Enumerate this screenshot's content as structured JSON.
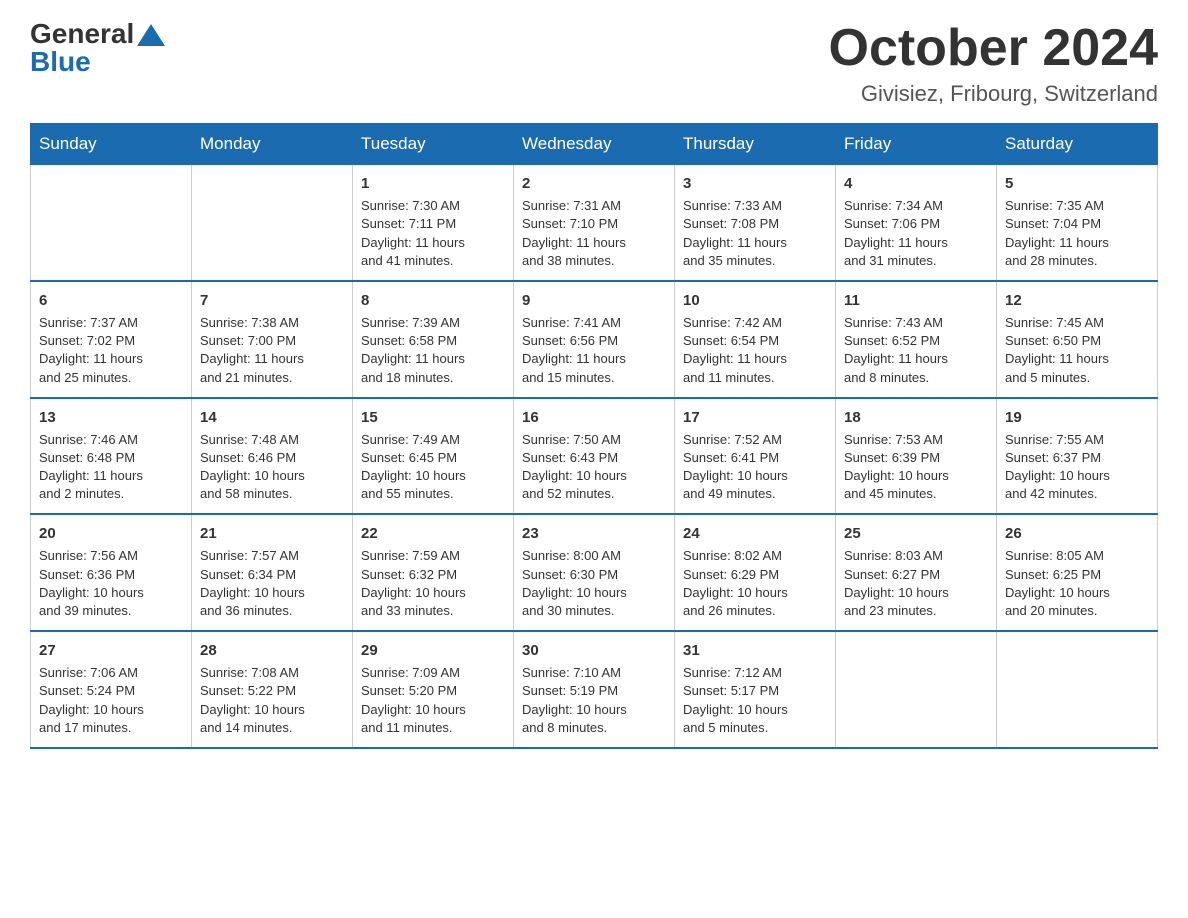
{
  "header": {
    "logo_general": "General",
    "logo_blue": "Blue",
    "month": "October 2024",
    "location": "Givisiez, Fribourg, Switzerland"
  },
  "days_of_week": [
    "Sunday",
    "Monday",
    "Tuesday",
    "Wednesday",
    "Thursday",
    "Friday",
    "Saturday"
  ],
  "weeks": [
    [
      {
        "day": "",
        "info": ""
      },
      {
        "day": "",
        "info": ""
      },
      {
        "day": "1",
        "info": "Sunrise: 7:30 AM\nSunset: 7:11 PM\nDaylight: 11 hours\nand 41 minutes."
      },
      {
        "day": "2",
        "info": "Sunrise: 7:31 AM\nSunset: 7:10 PM\nDaylight: 11 hours\nand 38 minutes."
      },
      {
        "day": "3",
        "info": "Sunrise: 7:33 AM\nSunset: 7:08 PM\nDaylight: 11 hours\nand 35 minutes."
      },
      {
        "day": "4",
        "info": "Sunrise: 7:34 AM\nSunset: 7:06 PM\nDaylight: 11 hours\nand 31 minutes."
      },
      {
        "day": "5",
        "info": "Sunrise: 7:35 AM\nSunset: 7:04 PM\nDaylight: 11 hours\nand 28 minutes."
      }
    ],
    [
      {
        "day": "6",
        "info": "Sunrise: 7:37 AM\nSunset: 7:02 PM\nDaylight: 11 hours\nand 25 minutes."
      },
      {
        "day": "7",
        "info": "Sunrise: 7:38 AM\nSunset: 7:00 PM\nDaylight: 11 hours\nand 21 minutes."
      },
      {
        "day": "8",
        "info": "Sunrise: 7:39 AM\nSunset: 6:58 PM\nDaylight: 11 hours\nand 18 minutes."
      },
      {
        "day": "9",
        "info": "Sunrise: 7:41 AM\nSunset: 6:56 PM\nDaylight: 11 hours\nand 15 minutes."
      },
      {
        "day": "10",
        "info": "Sunrise: 7:42 AM\nSunset: 6:54 PM\nDaylight: 11 hours\nand 11 minutes."
      },
      {
        "day": "11",
        "info": "Sunrise: 7:43 AM\nSunset: 6:52 PM\nDaylight: 11 hours\nand 8 minutes."
      },
      {
        "day": "12",
        "info": "Sunrise: 7:45 AM\nSunset: 6:50 PM\nDaylight: 11 hours\nand 5 minutes."
      }
    ],
    [
      {
        "day": "13",
        "info": "Sunrise: 7:46 AM\nSunset: 6:48 PM\nDaylight: 11 hours\nand 2 minutes."
      },
      {
        "day": "14",
        "info": "Sunrise: 7:48 AM\nSunset: 6:46 PM\nDaylight: 10 hours\nand 58 minutes."
      },
      {
        "day": "15",
        "info": "Sunrise: 7:49 AM\nSunset: 6:45 PM\nDaylight: 10 hours\nand 55 minutes."
      },
      {
        "day": "16",
        "info": "Sunrise: 7:50 AM\nSunset: 6:43 PM\nDaylight: 10 hours\nand 52 minutes."
      },
      {
        "day": "17",
        "info": "Sunrise: 7:52 AM\nSunset: 6:41 PM\nDaylight: 10 hours\nand 49 minutes."
      },
      {
        "day": "18",
        "info": "Sunrise: 7:53 AM\nSunset: 6:39 PM\nDaylight: 10 hours\nand 45 minutes."
      },
      {
        "day": "19",
        "info": "Sunrise: 7:55 AM\nSunset: 6:37 PM\nDaylight: 10 hours\nand 42 minutes."
      }
    ],
    [
      {
        "day": "20",
        "info": "Sunrise: 7:56 AM\nSunset: 6:36 PM\nDaylight: 10 hours\nand 39 minutes."
      },
      {
        "day": "21",
        "info": "Sunrise: 7:57 AM\nSunset: 6:34 PM\nDaylight: 10 hours\nand 36 minutes."
      },
      {
        "day": "22",
        "info": "Sunrise: 7:59 AM\nSunset: 6:32 PM\nDaylight: 10 hours\nand 33 minutes."
      },
      {
        "day": "23",
        "info": "Sunrise: 8:00 AM\nSunset: 6:30 PM\nDaylight: 10 hours\nand 30 minutes."
      },
      {
        "day": "24",
        "info": "Sunrise: 8:02 AM\nSunset: 6:29 PM\nDaylight: 10 hours\nand 26 minutes."
      },
      {
        "day": "25",
        "info": "Sunrise: 8:03 AM\nSunset: 6:27 PM\nDaylight: 10 hours\nand 23 minutes."
      },
      {
        "day": "26",
        "info": "Sunrise: 8:05 AM\nSunset: 6:25 PM\nDaylight: 10 hours\nand 20 minutes."
      }
    ],
    [
      {
        "day": "27",
        "info": "Sunrise: 7:06 AM\nSunset: 5:24 PM\nDaylight: 10 hours\nand 17 minutes."
      },
      {
        "day": "28",
        "info": "Sunrise: 7:08 AM\nSunset: 5:22 PM\nDaylight: 10 hours\nand 14 minutes."
      },
      {
        "day": "29",
        "info": "Sunrise: 7:09 AM\nSunset: 5:20 PM\nDaylight: 10 hours\nand 11 minutes."
      },
      {
        "day": "30",
        "info": "Sunrise: 7:10 AM\nSunset: 5:19 PM\nDaylight: 10 hours\nand 8 minutes."
      },
      {
        "day": "31",
        "info": "Sunrise: 7:12 AM\nSunset: 5:17 PM\nDaylight: 10 hours\nand 5 minutes."
      },
      {
        "day": "",
        "info": ""
      },
      {
        "day": "",
        "info": ""
      }
    ]
  ]
}
